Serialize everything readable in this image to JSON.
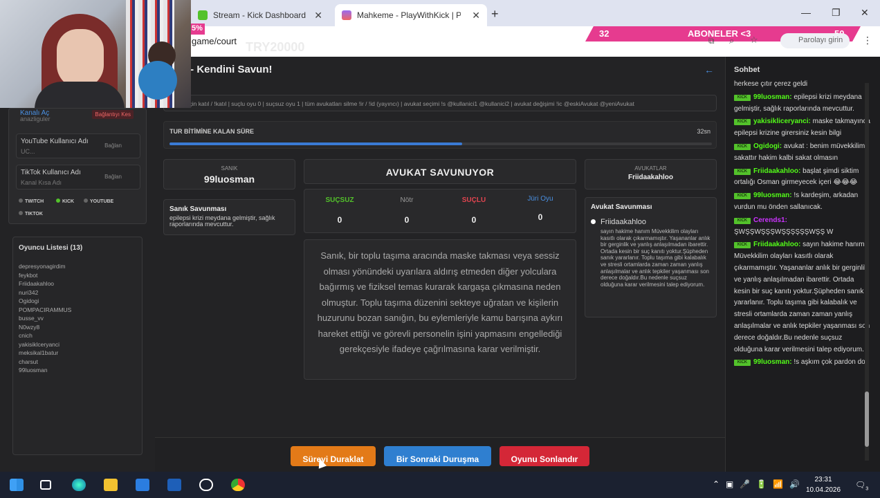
{
  "browser": {
    "tab1_title": "Stream - Kick Dashboard",
    "tab2_title": "Mahkeme - PlayWithKick | PlayWithKick",
    "url": "game/court",
    "watermark": "TRY20000",
    "password_btn": "Parolayı girin"
  },
  "overlay": {
    "banner_left": "32",
    "banner_text": "ABONELER <3",
    "banner_right": "50",
    "percent": "5%"
  },
  "left": {
    "account_label": "Kanalı Aç",
    "account_sub": "anazliguler",
    "account_btn": "Bağlantıyı Kes",
    "youtube_label": "YouTube Kullanıcı Adı",
    "youtube_sub": "UC...",
    "youtube_btn": "Bağlan",
    "tiktok_label": "TikTok Kullanıcı Adı",
    "tiktok_sub": "Kanal Kısa Adı",
    "tiktok_btn": "Bağlan",
    "platforms": [
      "TWITCH",
      "KICK",
      "YOUTUBE",
      "TIKTOK"
    ]
  },
  "players": {
    "title": "Oyuncu Listesi (13)",
    "list": [
      "depresyonagirdim",
      "feykbot",
      "Friidaakahloo",
      "nuri342",
      "Ogidogi",
      "POMPACIRAMMUS",
      "busse_vv",
      "N0wzy8",
      "cnich",
      "yakisiklceryanci",
      "meksikal1batur",
      "charsut",
      "99luosman"
    ]
  },
  "main": {
    "title": "t - Kendini Savun!",
    "commands": "s için katıl / !katıl | suçlu oyu 0 | suçsuz oyu 1 | tüm avukatları silme !ir / !id (yayıncı) | avukat seçimi !s @kullanici1 @kullanici2 | avukat değişimi !ic @eskiAvukat @yeniAvukat",
    "timer_label": "TUR BİTİMİNE KALAN SÜRE",
    "timer_value": "32sn",
    "timer_fraction": 0.54,
    "defendant_label": "SANIK",
    "defendant_name": "99luosman",
    "defendant_def_title": "Sanık Savunması",
    "defendant_def_text": "epilepsi krizi meydana gelmiştir, sağlık raporlarında mevcuttur.",
    "status": "AVUKAT SAVUNUYOR",
    "votes": [
      {
        "label": "SUÇSUZ",
        "count": "0",
        "color": "#53c22b"
      },
      {
        "label": "Nötr",
        "count": "0",
        "color": "#999999"
      },
      {
        "label": "SUÇLU",
        "count": "0",
        "color": "#e0444f"
      },
      {
        "label": "Jüri Oyu",
        "count": "0",
        "color": "#4a90e2"
      }
    ],
    "case_text": "Sanık, bir toplu taşıma aracında maske takması veya sessiz olması yönündeki uyarılara aldırış etmeden diğer yolculara bağırmış ve fiziksel temas kurarak kargaşa çıkmasına neden olmuştur. Toplu taşıma düzenini sekteye uğratan ve kişilerin huzurunu bozan sanığın, bu eylemleriyle kamu barışına aykırı hareket ettiği ve görevli personelin işini yapmasını engellediği gerekçesiyle ifadeye çağrılmasına karar verilmiştir.",
    "lawyers_label": "AVUKATLAR",
    "lawyers_name": "Friidaakahloo",
    "lawyer_def_title": "Avukat Savunması",
    "lawyer_def_name": "Friidaakahloo",
    "lawyer_def_text": "sayın hakime hanım Müvekkilim olayları kasıtlı olarak çıkarmamıştır. Yaşananlar anlık bir gerginlik ve yanlış anlaşılmadan ibarettir. Ortada kesin bir suç kanıtı yoktur.Şüpheden sanık yararlanır. Toplu taşıma gibi kalabalık ve stresli ortamlarda zaman zaman yanlış anlaşılmalar ve anlık tepkiler yaşanması son derece doğaldır.Bu nedenle suçsuz olduğuna karar verilmesini talep ediyorum.",
    "btn_pause": "Süreyi Duraklat",
    "btn_next": "Bir Sonraki Duruşma",
    "btn_end": "Oyunu Sonlandır"
  },
  "chat": {
    "title": "Sohbet",
    "messages": [
      {
        "user": "",
        "text": "herkese çıtır çerez geldi"
      },
      {
        "user": "99luosman:",
        "text": "epilepsi krizi meydana gelmiştir, sağlık raporlarında mevcuttur."
      },
      {
        "user": "yakisikliceryanci:",
        "text": "maske takmayınca epilepsi krizine girersiniz kesin bilgi"
      },
      {
        "user": "Ogidogi:",
        "text": "avukat : benim müvekkilim sakattır hakim kalbi sakat olmasın"
      },
      {
        "user": "Friidaakahloo:",
        "text": "başlat şimdi siktim ortalığı Osman girmeyecek içeri 😂😂😂"
      },
      {
        "user": "99luosman:",
        "text": "!s kardeşim, arkadan vurdun mu önden sallanıcak."
      },
      {
        "user": "Cerends1:",
        "text": "ŞWŞŞWŞŞŞWŞŞŞŞŞŞWŞŞ W"
      },
      {
        "user": "Friidaakahloo:",
        "text": "sayın hakime hanım Müvekkilim olayları kasıtlı olarak çıkarmamıştır. Yaşananlar anlık bir gerginlik ve yanlış anlaşılmadan ibarettir. Ortada kesin bir suç kanıtı yoktur.Şüpheden sanık yararlanır. Toplu taşıma gibi kalabalık ve stresli ortamlarda zaman zaman yanlış anlaşılmalar ve anlık tepkiler yaşanması son derece doğaldır.Bu nedenle suçsuz olduğuna karar verilmesini talep ediyorum."
      },
      {
        "user": "99luosman:",
        "text": "!s aşkım çok pardon don"
      }
    ]
  },
  "taskbar": {
    "time": "23:31",
    "date": "10.04.2026",
    "notif_count": "3"
  }
}
